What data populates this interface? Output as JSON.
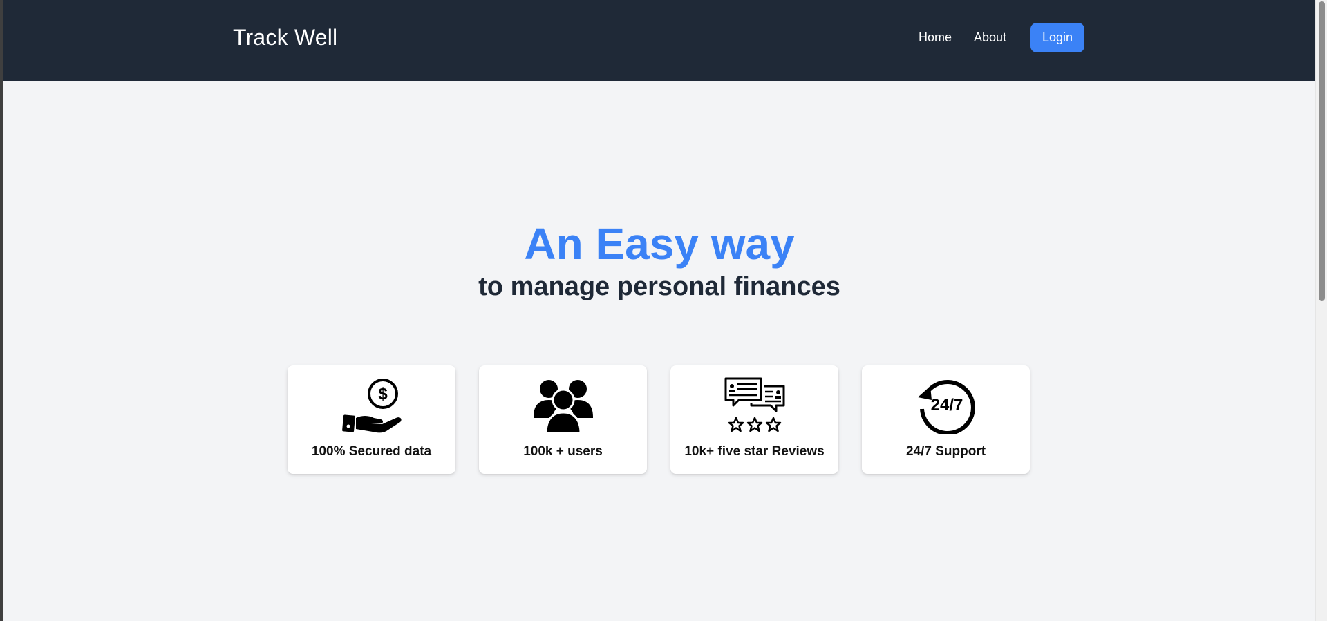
{
  "navbar": {
    "brand": "Track Well",
    "links": [
      {
        "label": "Home"
      },
      {
        "label": "About"
      }
    ],
    "login_label": "Login"
  },
  "hero": {
    "title": "An Easy way",
    "subtitle": "to manage personal finances"
  },
  "features": [
    {
      "icon": "hand-coin-icon",
      "label": "100% Secured data"
    },
    {
      "icon": "users-group-icon",
      "label": "100k + users"
    },
    {
      "icon": "reviews-stars-icon",
      "label": "10k+ five star Reviews"
    },
    {
      "icon": "support-247-icon",
      "label": "24/7 Support",
      "icon_text": "24/7"
    }
  ],
  "colors": {
    "navbar_bg": "#1f2937",
    "accent": "#3b82f6",
    "page_bg": "#f3f4f6",
    "card_bg": "#ffffff"
  }
}
